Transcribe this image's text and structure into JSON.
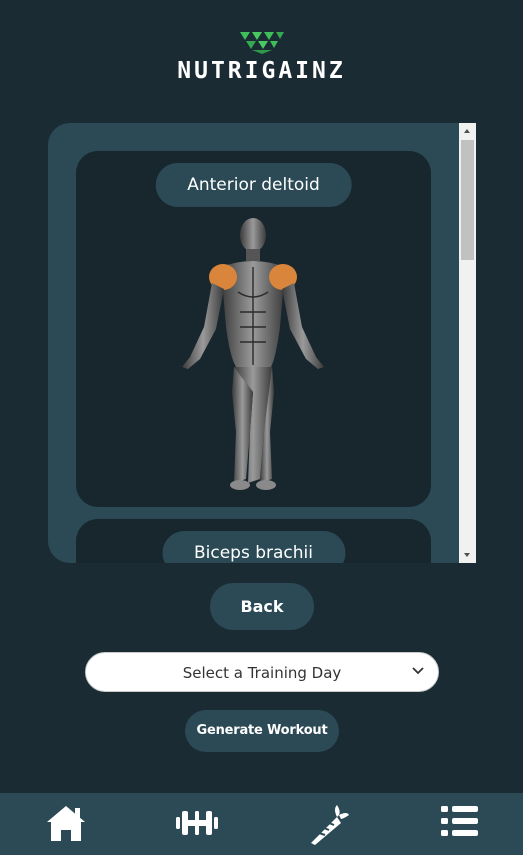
{
  "app": {
    "brand": "NUTRIGAINZ"
  },
  "muscles": [
    {
      "label": "Anterior deltoid"
    },
    {
      "label": "Biceps brachii"
    }
  ],
  "buttons": {
    "back": "Back",
    "generate": "Generate Workout"
  },
  "training_day": {
    "selected": "Select a Training Day"
  },
  "nav": [
    {
      "icon": "home-icon"
    },
    {
      "icon": "dumbbell-icon"
    },
    {
      "icon": "carrot-icon"
    },
    {
      "icon": "list-icon"
    }
  ],
  "colors": {
    "background": "#1b2b33",
    "panel": "#2b4a56",
    "card": "#18262d",
    "logo_green": "#3fbf5a",
    "highlight_muscle": "#d9853b"
  }
}
